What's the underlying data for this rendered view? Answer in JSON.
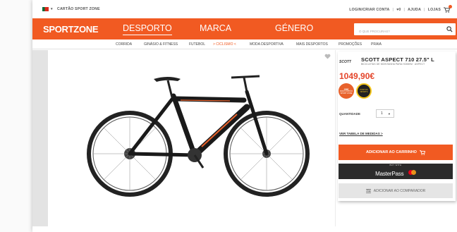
{
  "topbar": {
    "club_label": "CARTÃO SPORT ZONE",
    "login_label": "LOGIN/CRIAR CONTA",
    "wishlist_label": "♥0",
    "help_label": "AJUDA",
    "stores_label": "LOJAS"
  },
  "nav": {
    "logo_sport": "SPORT",
    "logo_zone": "ZONE",
    "links": [
      "DESPORTO",
      "MARCA",
      "GÉNERO"
    ],
    "search_placeholder": "O QUE PROCURAS?"
  },
  "subnav": {
    "items": [
      "CORRIDA",
      "GINÁSIO & FITNESS",
      "FUTEBOL",
      "> CICLISMO <",
      "MODA DESPORTIVA",
      "MAIS DESPORTOS",
      "PROMOÇÕES",
      "PRAIA"
    ]
  },
  "product": {
    "brand_logo": "SCOTT",
    "title": "SCOTT ASPECT 710 27.5\" L",
    "subtitle": "BICICLETAS DE MONTANHA PARA HOMEM · ASPECT",
    "price": "1049,90€",
    "badge1_line1": "20€",
    "badge1_line2": "PARA CARTÃO",
    "badge1_line3": "SPORT ZONE",
    "badge2_line1": "PONTOS",
    "badge2_line2": "SPORTS",
    "qty_label": "QUANTIDADE",
    "qty_value": "1",
    "size_link": "VER TABELA DE MEDIDAS >",
    "add_to_cart": "ADICIONAR AO CARRINHO",
    "masterpass_buy": "BUY WITH",
    "masterpass_name": "MasterPass",
    "compare": "ADICIONAR AO COMPARADOR"
  },
  "colors": {
    "brand_orange": "#f15a22",
    "price_red": "#e4452a"
  }
}
